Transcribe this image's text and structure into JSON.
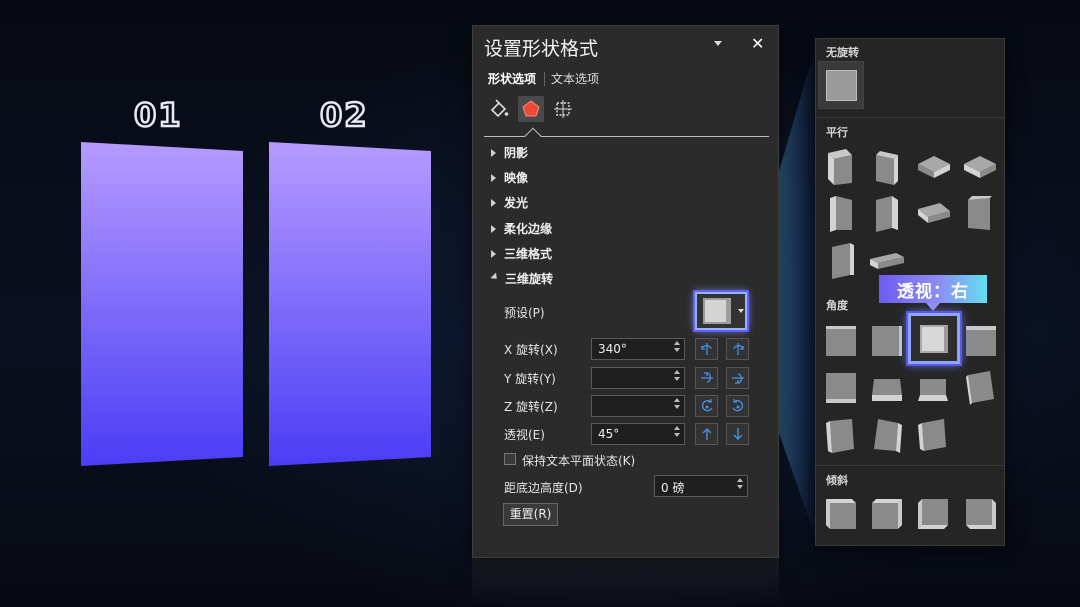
{
  "slide": {
    "label_1": "01",
    "label_2": "02",
    "panel_gradient_top": "#b59bff",
    "panel_gradient_bottom": "#4a3df5"
  },
  "pane": {
    "title": "设置形状格式",
    "tabs": [
      {
        "label": "形状选项",
        "active": true
      },
      {
        "label": "文本选项",
        "active": false
      }
    ],
    "icons": [
      "fill-line-icon",
      "effects-icon",
      "size-properties-icon"
    ],
    "sections": [
      {
        "label": "阴影",
        "expanded": false
      },
      {
        "label": "映像",
        "expanded": false
      },
      {
        "label": "发光",
        "expanded": false
      },
      {
        "label": "柔化边缘",
        "expanded": false
      },
      {
        "label": "三维格式",
        "expanded": false
      },
      {
        "label": "三维旋转",
        "expanded": true
      }
    ],
    "rotation": {
      "preset_label": "预设(P)",
      "x_label": "X 旋转(X)",
      "x_value": "340°",
      "y_label": "Y 旋转(Y)",
      "y_value": "",
      "z_label": "Z 旋转(Z)",
      "z_value": "",
      "perspective_label": "透视(E)",
      "perspective_value": "45°",
      "keep_text_flat_label": "保持文本平面状态(K)",
      "distance_label": "距底边高度(D)",
      "distance_value": "0 磅",
      "reset_label": "重置(R)"
    }
  },
  "gallery": {
    "sections": [
      {
        "label": "无旋转"
      },
      {
        "label": "平行"
      },
      {
        "label": "角度"
      },
      {
        "label": "倾斜"
      }
    ],
    "callout": "透视：右"
  },
  "colors": {
    "accent_blue": "#4a8fe0",
    "highlight": "#8fa6ff",
    "beam": "#5fd6e8"
  }
}
